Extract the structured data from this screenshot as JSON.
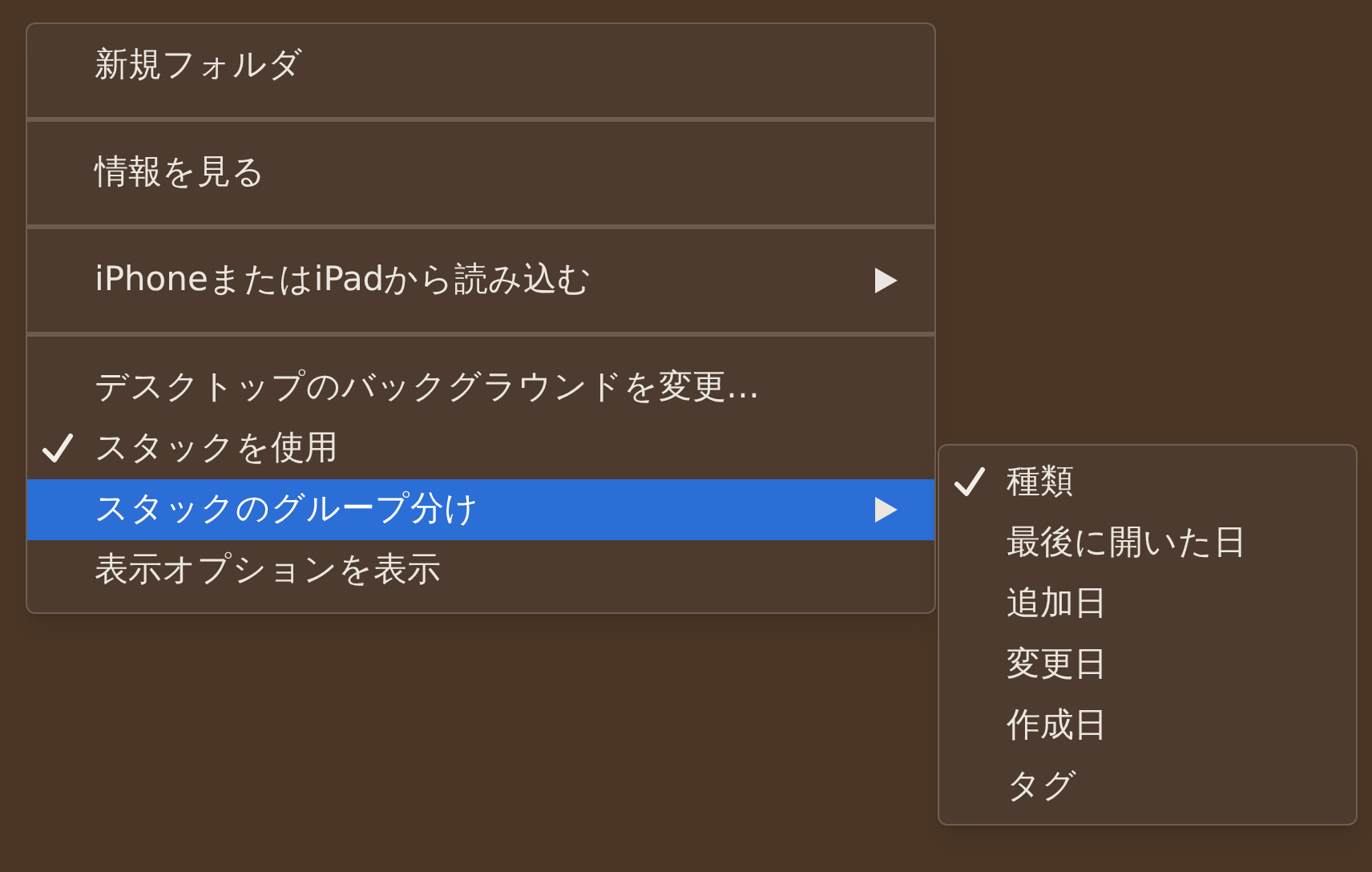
{
  "menu": {
    "items": [
      {
        "kind": "item",
        "label": "新規フォルダ",
        "checked": false,
        "selected": false,
        "submenu": false
      },
      {
        "kind": "separator"
      },
      {
        "kind": "item",
        "label": "情報を見る",
        "checked": false,
        "selected": false,
        "submenu": false
      },
      {
        "kind": "separator"
      },
      {
        "kind": "item",
        "label": "iPhoneまたはiPadから読み込む",
        "checked": false,
        "selected": false,
        "submenu": true
      },
      {
        "kind": "separator"
      },
      {
        "kind": "item",
        "label": "デスクトップのバックグラウンドを変更…",
        "checked": false,
        "selected": false,
        "submenu": false
      },
      {
        "kind": "item",
        "label": "スタックを使用",
        "checked": true,
        "selected": false,
        "submenu": false
      },
      {
        "kind": "item",
        "label": "スタックのグループ分け",
        "checked": false,
        "selected": true,
        "submenu": true
      },
      {
        "kind": "item",
        "label": "表示オプションを表示",
        "checked": false,
        "selected": false,
        "submenu": false
      }
    ]
  },
  "submenu": {
    "items": [
      {
        "kind": "item",
        "label": "種類",
        "checked": true,
        "selected": false,
        "submenu": false
      },
      {
        "kind": "item",
        "label": "最後に開いた日",
        "checked": false,
        "selected": false,
        "submenu": false
      },
      {
        "kind": "item",
        "label": "追加日",
        "checked": false,
        "selected": false,
        "submenu": false
      },
      {
        "kind": "item",
        "label": "変更日",
        "checked": false,
        "selected": false,
        "submenu": false
      },
      {
        "kind": "item",
        "label": "作成日",
        "checked": false,
        "selected": false,
        "submenu": false
      },
      {
        "kind": "item",
        "label": "タグ",
        "checked": false,
        "selected": false,
        "submenu": false
      }
    ]
  }
}
